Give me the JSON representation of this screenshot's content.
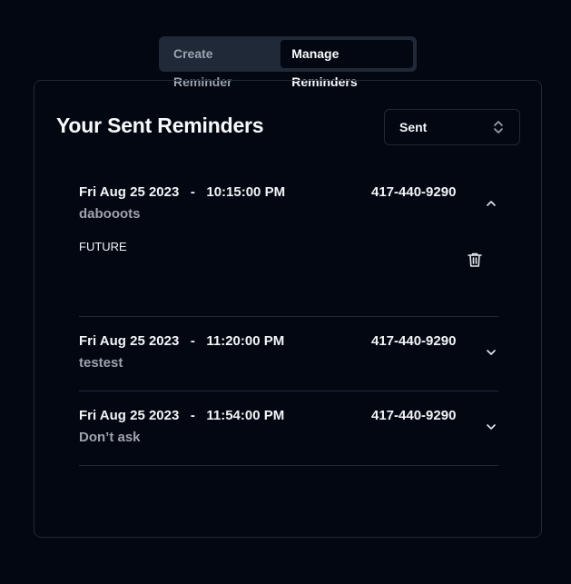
{
  "tabs": {
    "create_label": "Create Reminder",
    "manage_label": "Manage Reminders"
  },
  "card": {
    "title": "Your Sent Reminders",
    "filter_value": "Sent"
  },
  "reminders": [
    {
      "date": "Fri Aug 25 2023",
      "sep": "-",
      "time": "10:15:00 PM",
      "phone": "417-440-9290",
      "message": "dabooots",
      "status": "FUTURE",
      "expanded": true
    },
    {
      "date": "Fri Aug 25 2023",
      "sep": "-",
      "time": "11:20:00 PM",
      "phone": "417-440-9290",
      "message": "testest",
      "expanded": false
    },
    {
      "date": "Fri Aug 25 2023",
      "sep": "-",
      "time": "11:54:00 PM",
      "phone": "417-440-9290",
      "message": "Don’t ask",
      "expanded": false
    }
  ]
}
